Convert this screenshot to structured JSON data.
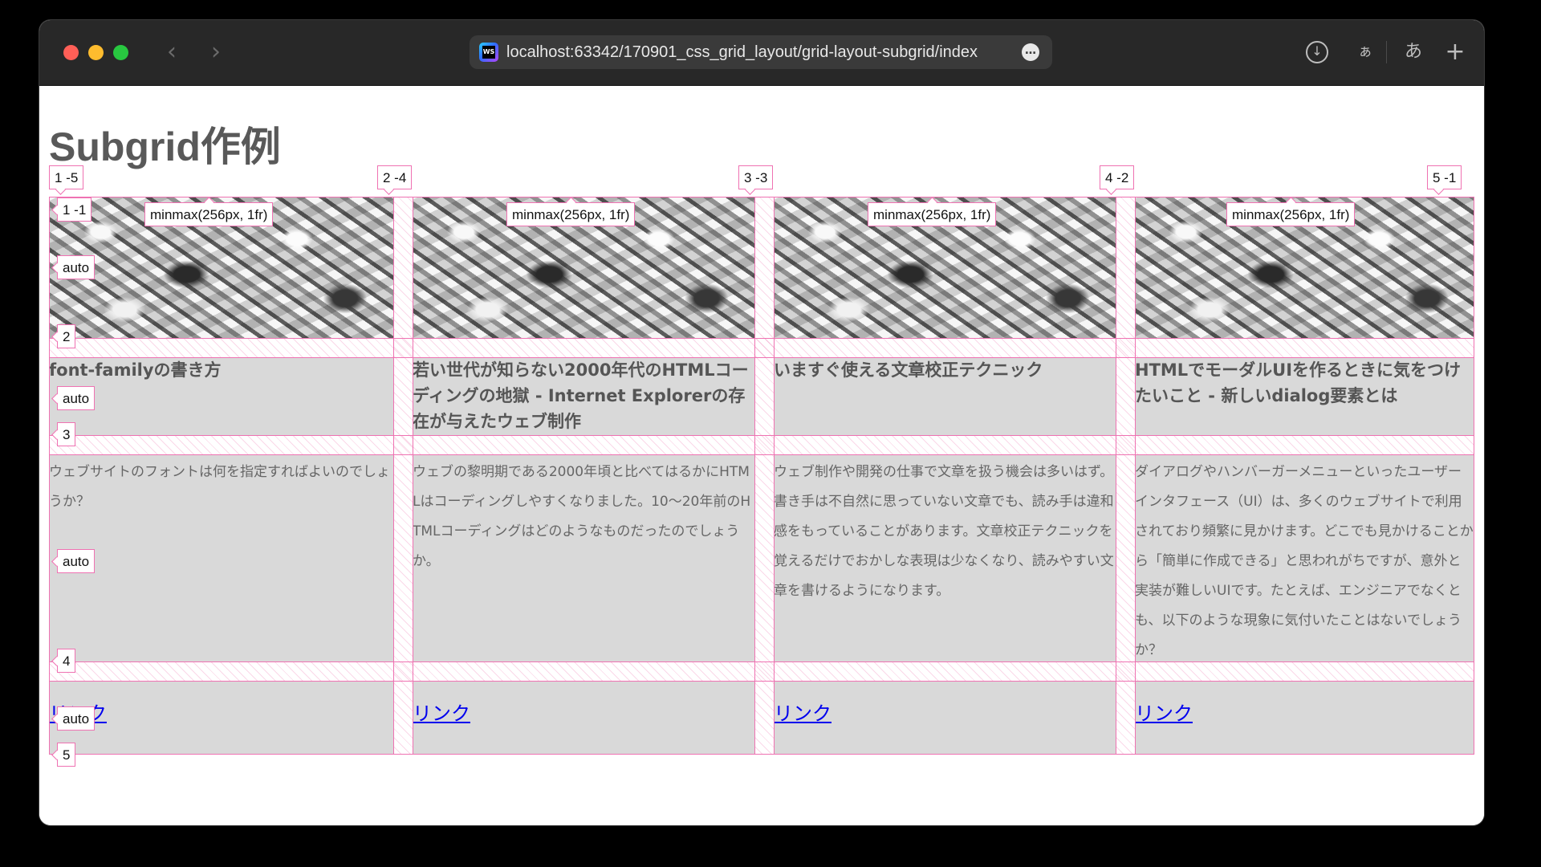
{
  "browser": {
    "url": "localhost:63342/170901_css_grid_layout/grid-layout-subgrid/index",
    "ide_badge": "WS",
    "more_icon": "ellipsis-icon",
    "download_icon": "download-icon",
    "plus_label": "+",
    "hiragana_small": "ぁ",
    "hiragana_large": "あ"
  },
  "page": {
    "title": "Subgrid作例"
  },
  "grid_overlay": {
    "column_labels": [
      "1 -5",
      "2 -4",
      "3 -3",
      "4 -2",
      "5 -1"
    ],
    "row_labels": {
      "top": "1 -1",
      "r2": "2",
      "r3": "3",
      "r4": "4",
      "r5": "5"
    },
    "track_size_label": "minmax(256px, 1fr)",
    "auto_label": "auto"
  },
  "cards": [
    {
      "title": "font-familyの書き方",
      "description": "ウェブサイトのフォントは何を指定すればよいのでしょうか？",
      "link": "リンク"
    },
    {
      "title": "若い世代が知らない2000年代のHTMLコーディングの地獄 - Internet Explorerの存在が与えたウェブ制作",
      "description": "ウェブの黎明期である2000年頃と比べてはるかにHTMLはコーディングしやすくなりました。10〜20年前のHTMLコーディングはどのようなものだったのでしょうか。",
      "link": "リンク"
    },
    {
      "title": "いますぐ使える文章校正テクニック",
      "description": "ウェブ制作や開発の仕事で文章を扱う機会は多いはず。書き手は不自然に思っていない文章でも、読み手は違和感をもっていることがあります。文章校正テクニックを覚えるだけでおかしな表現は少なくなり、読みやすい文章を書けるようになります。",
      "link": "リンク"
    },
    {
      "title": "HTMLでモーダルUIを作るときに気をつけたいこと - 新しいdialog要素とは",
      "description": "ダイアログやハンバーガーメニューといったユーザーインタフェース（UI）は、多くのウェブサイトで利用されており頻繁に見かけます。どこでも見かけることから「簡単に作成できる」と思われがちですが、意外と実装が難しいUIです。たとえば、エンジニアでなくとも、以下のような現象に気付いたことはないでしょうか？",
      "link": "リンク"
    }
  ]
}
